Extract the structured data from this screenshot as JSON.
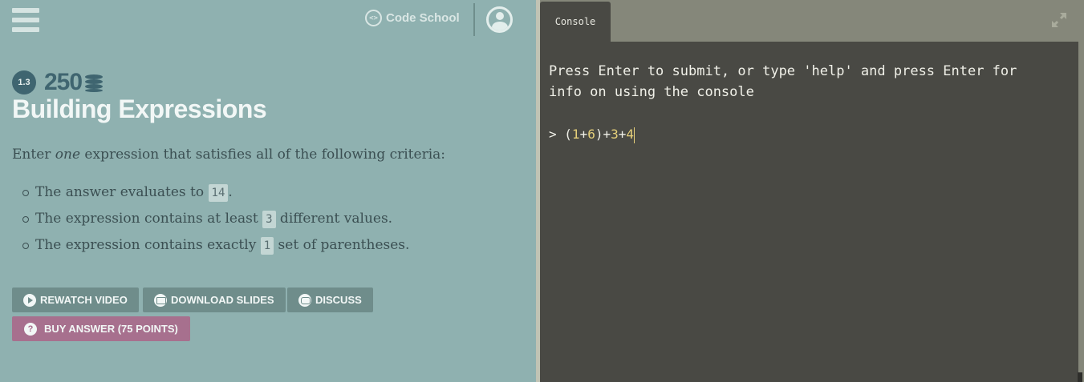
{
  "header": {
    "brand": "Code School",
    "brand_icon": "code-brackets-icon",
    "menu_icon": "hamburger-icon",
    "profile_icon": "user-avatar-icon"
  },
  "challenge": {
    "level": "1.3",
    "points": "250",
    "points_icon": "coins-stack-icon",
    "title": "Building Expressions",
    "intro_before": "Enter ",
    "intro_emphasis": "one",
    "intro_after": " expression that satisfies all of the following criteria:",
    "criteria": [
      {
        "before": "The answer evaluates to ",
        "code": "14",
        "after": "."
      },
      {
        "before": "The expression contains at least ",
        "code": "3",
        "after": " different values."
      },
      {
        "before": "The expression contains exactly ",
        "code": "1",
        "after": " set of parentheses."
      }
    ]
  },
  "actions": {
    "rewatch": "REWATCH VIDEO",
    "download": "DOWNLOAD SLIDES",
    "discuss": "DISCUSS",
    "buy": "BUY ANSWER (75 POINTS)",
    "buy_icon_glyph": "?"
  },
  "console": {
    "tab_label": "Console",
    "message": "Press Enter to submit, or type 'help' and press Enter for\ninfo on using the console",
    "prompt": ">",
    "input_parts": [
      "(",
      "1",
      "+",
      "6",
      ")+",
      "3",
      "+",
      "4"
    ]
  },
  "colors": {
    "left_bg": "#8fb1b0",
    "console_bg": "#494944",
    "accent_teal": "#3f6570",
    "buy_button": "#a7708e",
    "number_highlight": "#e6d07a"
  }
}
